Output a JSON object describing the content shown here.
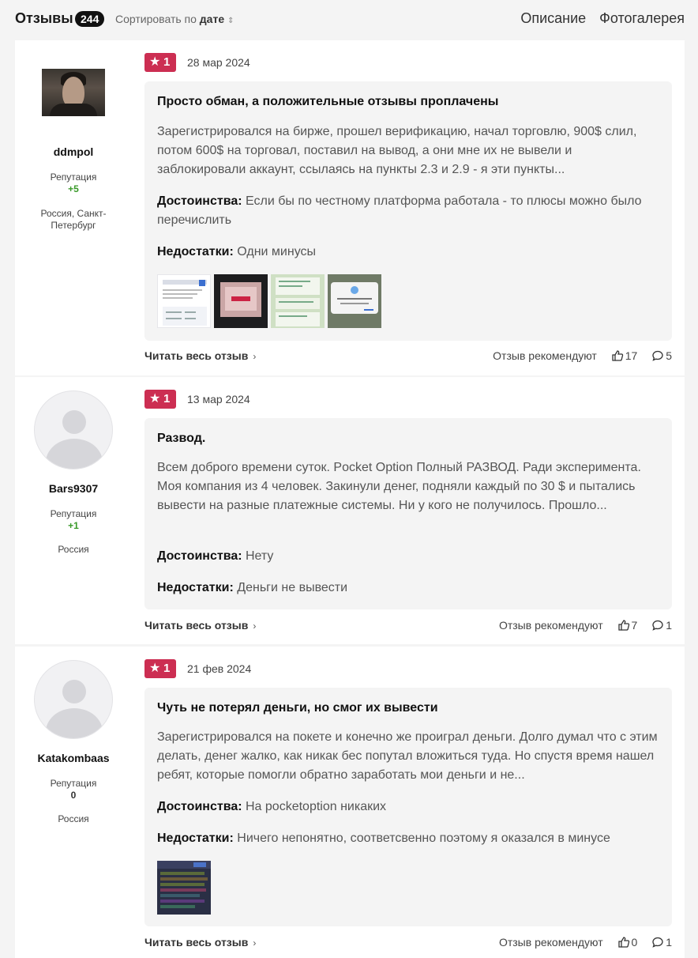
{
  "header": {
    "title": "Отзывы",
    "count": "244",
    "sort_prefix": "Сортировать по",
    "sort_value": "дате",
    "tabs": [
      "Описание",
      "Фотогалерея"
    ]
  },
  "reviews": [
    {
      "author": "ddmpol",
      "reputation_label": "Репутация",
      "reputation": "+5",
      "location": "Россия, Санкт-Петербург",
      "rating": "1",
      "date": "28 мар 2024",
      "title": "Просто обман, а положительные отзывы проплачены",
      "text": "Зарегистрировался на бирже, прошел верификацию, начал торговлю, 900$ слил, потом 600$ на торговал, поставил на вывод, а они мне их не вывели и заблокировали аккаунт, ссылаясь на пункты 2.3 и 2.9 - я эти пункты...",
      "pros_label": "Достоинства:",
      "pros": "Если бы по честному платформа работала - то плюсы можно было перечислить",
      "cons_label": "Недостатки:",
      "cons": "Одни минусы",
      "read_more": "Читать весь отзыв",
      "recommend_label": "Отзыв рекомендуют",
      "likes": "17",
      "comments": "5"
    },
    {
      "author": "Bars9307",
      "reputation_label": "Репутация",
      "reputation": "+1",
      "location": "Россия",
      "rating": "1",
      "date": "13 мар 2024",
      "title": "Развод.",
      "text": "Всем доброго времени суток. Pocket Option Полный РАЗВОД. Ради эксперимента. Моя компания из 4 человек. Закинули денег, подняли каждый по 30 $ и пытались вывести на разные платежные системы. Ни у кого не получилось. Прошло...",
      "pros_label": "Достоинства:",
      "pros": "Нету",
      "cons_label": "Недостатки:",
      "cons": "Деньги не вывести",
      "read_more": "Читать весь отзыв",
      "recommend_label": "Отзыв рекомендуют",
      "likes": "7",
      "comments": "1"
    },
    {
      "author": "Katakombaas",
      "reputation_label": "Репутация",
      "reputation": "0",
      "location": "Россия",
      "rating": "1",
      "date": "21 фев 2024",
      "title": "Чуть не потерял деньги, но смог их вывести",
      "text": "Зарегистрировался на покете и конечно же проиграл деньги. Долго думал что с этим делать, денег жалко, как никак бес попутал вложиться туда. Но спустя время нашел ребят, которые помогли обратно заработать мои деньги и не...",
      "pros_label": "Достоинства:",
      "pros": "На pocketoption никаких",
      "cons_label": "Недостатки:",
      "cons": "Ничего непонятно, соответсвенно поэтому я оказался в минусе",
      "read_more": "Читать весь отзыв",
      "recommend_label": "Отзыв рекомендуют",
      "likes": "0",
      "comments": "1"
    }
  ],
  "colors": {
    "rating_bg": "#cc2e52",
    "reputation_positive": "#3a9a2a",
    "reputation_zero": "#333333"
  }
}
